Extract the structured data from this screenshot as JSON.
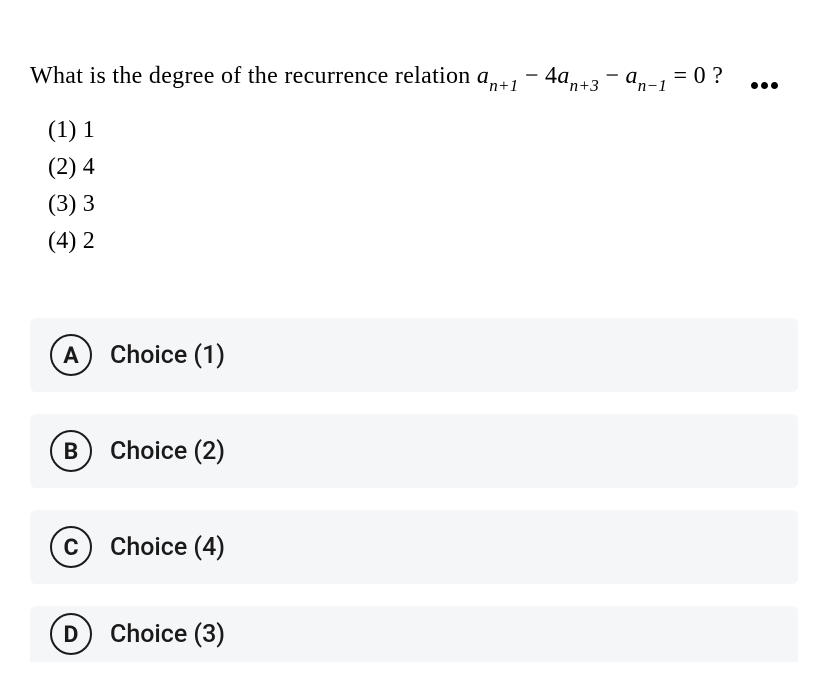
{
  "question": {
    "prefix": "What is the degree of the recurrence relation ",
    "equation_parts": {
      "a1": "a",
      "sub1": "n+1",
      "minus1": " − 4",
      "a2": "a",
      "sub2": "n+3",
      "minus2": " − ",
      "a3": "a",
      "sub3": "n−1",
      "eq": " = 0 ?"
    }
  },
  "options": {
    "o1": "(1)  1",
    "o2": "(2)  4",
    "o3": "(3)  3",
    "o4": "(4)  2"
  },
  "choices": [
    {
      "letter": "A",
      "label": "Choice (1)"
    },
    {
      "letter": "B",
      "label": "Choice (2)"
    },
    {
      "letter": "C",
      "label": "Choice (4)"
    },
    {
      "letter": "D",
      "label": "Choice (3)"
    }
  ]
}
